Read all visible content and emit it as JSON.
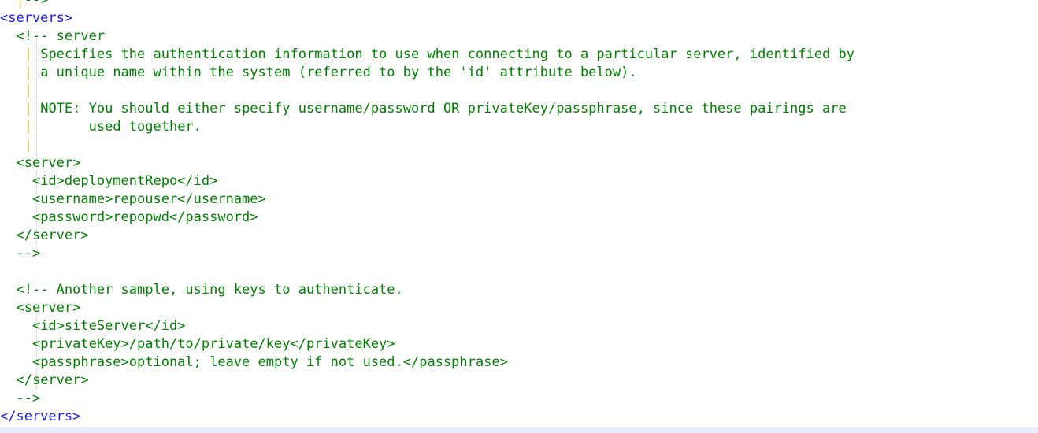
{
  "editor": {
    "language": "xml",
    "font_size_px": 17,
    "line_height_px": 23,
    "background": "#ffffff",
    "colors": {
      "tag": "#1a1aee",
      "comment": "#008000",
      "indent_pipe": "#c3c83c",
      "indent_guide": "#c8c8c8",
      "bottom_band": "#e9ecfb"
    }
  },
  "code": {
    "lines": [
      {
        "indent": "  ",
        "segments": [
          {
            "kind": "pipe",
            "text": "|"
          },
          {
            "kind": "comment",
            "text": "-->"
          }
        ]
      },
      {
        "indent": "",
        "segments": [
          {
            "kind": "tag",
            "text": "<servers>"
          }
        ]
      },
      {
        "indent": "  ",
        "segments": [
          {
            "kind": "comment",
            "text": "<!-- server"
          }
        ]
      },
      {
        "indent": "   ",
        "segments": [
          {
            "kind": "pipe",
            "text": "|"
          },
          {
            "kind": "comment",
            "text": " Specifies the authentication information to use when connecting to a particular server, identified by"
          }
        ]
      },
      {
        "indent": "   ",
        "segments": [
          {
            "kind": "pipe",
            "text": "|"
          },
          {
            "kind": "comment",
            "text": " a unique name within the system (referred to by the 'id' attribute below)."
          }
        ]
      },
      {
        "indent": "   ",
        "segments": [
          {
            "kind": "pipe",
            "text": "|"
          },
          {
            "kind": "comment",
            "text": ""
          }
        ]
      },
      {
        "indent": "   ",
        "segments": [
          {
            "kind": "pipe",
            "text": "|"
          },
          {
            "kind": "comment",
            "text": " NOTE: You should either specify username/password OR privateKey/passphrase, since these pairings are"
          }
        ]
      },
      {
        "indent": "   ",
        "segments": [
          {
            "kind": "pipe",
            "text": "|"
          },
          {
            "kind": "comment",
            "text": "       used together."
          }
        ]
      },
      {
        "indent": "   ",
        "segments": [
          {
            "kind": "pipe",
            "text": "|"
          },
          {
            "kind": "comment",
            "text": ""
          }
        ]
      },
      {
        "indent": "  ",
        "segments": [
          {
            "kind": "comment",
            "text": "<server>"
          }
        ]
      },
      {
        "indent": "    ",
        "segments": [
          {
            "kind": "comment",
            "text": "<id>deploymentRepo</id>"
          }
        ]
      },
      {
        "indent": "    ",
        "segments": [
          {
            "kind": "comment",
            "text": "<username>repouser</username>"
          }
        ]
      },
      {
        "indent": "    ",
        "segments": [
          {
            "kind": "comment",
            "text": "<password>repopwd</password>"
          }
        ]
      },
      {
        "indent": "  ",
        "segments": [
          {
            "kind": "comment",
            "text": "</server>"
          }
        ]
      },
      {
        "indent": "  ",
        "segments": [
          {
            "kind": "comment",
            "text": "-->"
          }
        ]
      },
      {
        "indent": "",
        "segments": []
      },
      {
        "indent": "  ",
        "segments": [
          {
            "kind": "comment",
            "text": "<!-- Another sample, using keys to authenticate."
          }
        ]
      },
      {
        "indent": "  ",
        "segments": [
          {
            "kind": "comment",
            "text": "<server>"
          }
        ]
      },
      {
        "indent": "    ",
        "segments": [
          {
            "kind": "comment",
            "text": "<id>siteServer</id>"
          }
        ]
      },
      {
        "indent": "    ",
        "segments": [
          {
            "kind": "comment",
            "text": "<privateKey>/path/to/private/key</privateKey>"
          }
        ]
      },
      {
        "indent": "    ",
        "segments": [
          {
            "kind": "comment",
            "text": "<passphrase>optional; leave empty if not used.</passphrase>"
          }
        ]
      },
      {
        "indent": "  ",
        "segments": [
          {
            "kind": "comment",
            "text": "</server>"
          }
        ]
      },
      {
        "indent": "  ",
        "segments": [
          {
            "kind": "comment",
            "text": "-->"
          }
        ]
      },
      {
        "indent": "",
        "segments": [
          {
            "kind": "tag",
            "text": "</servers>"
          }
        ]
      }
    ]
  }
}
